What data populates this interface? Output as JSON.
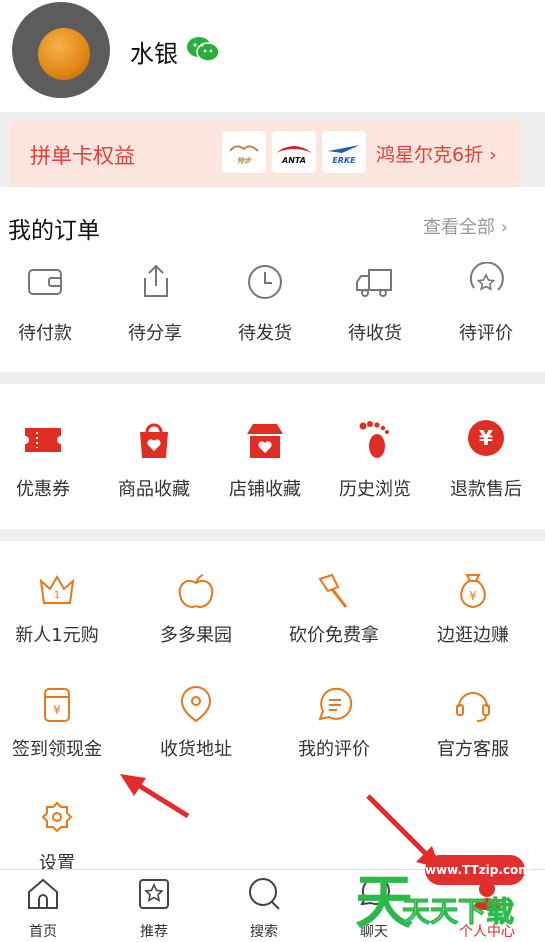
{
  "profile": {
    "username": "水银"
  },
  "banner": {
    "title": "拼单卡权益",
    "promo": "鸿星尔克6折",
    "brand_logo_1": "特步",
    "brand_logo_2": "ANTA",
    "brand_logo_3": "ERKE"
  },
  "orders": {
    "title": "我的订单",
    "view_all": "查看全部",
    "items": [
      {
        "label": "待付款"
      },
      {
        "label": "待分享"
      },
      {
        "label": "待发货"
      },
      {
        "label": "待收货"
      },
      {
        "label": "待评价"
      }
    ]
  },
  "collections": {
    "items": [
      {
        "label": "优惠券"
      },
      {
        "label": "商品收藏"
      },
      {
        "label": "店铺收藏"
      },
      {
        "label": "历史浏览"
      },
      {
        "label": "退款售后"
      }
    ]
  },
  "tools": {
    "items": [
      {
        "label": "新人1元购"
      },
      {
        "label": "多多果园"
      },
      {
        "label": "砍价免费拿"
      },
      {
        "label": "边逛边赚"
      },
      {
        "label": "签到领现金"
      },
      {
        "label": "收货地址"
      },
      {
        "label": "我的评价"
      },
      {
        "label": "官方客服"
      },
      {
        "label": "设置"
      }
    ]
  },
  "nav": {
    "items": [
      {
        "label": "首页"
      },
      {
        "label": "推荐"
      },
      {
        "label": "搜索"
      },
      {
        "label": "聊天"
      },
      {
        "label": "个人中心"
      }
    ]
  },
  "watermark": {
    "url": "www.TTzip.com",
    "brand": "天天下载"
  },
  "colors": {
    "accent": "#e02e24",
    "tool_orange": "#e9781b",
    "nav_active": "#e02e24"
  }
}
